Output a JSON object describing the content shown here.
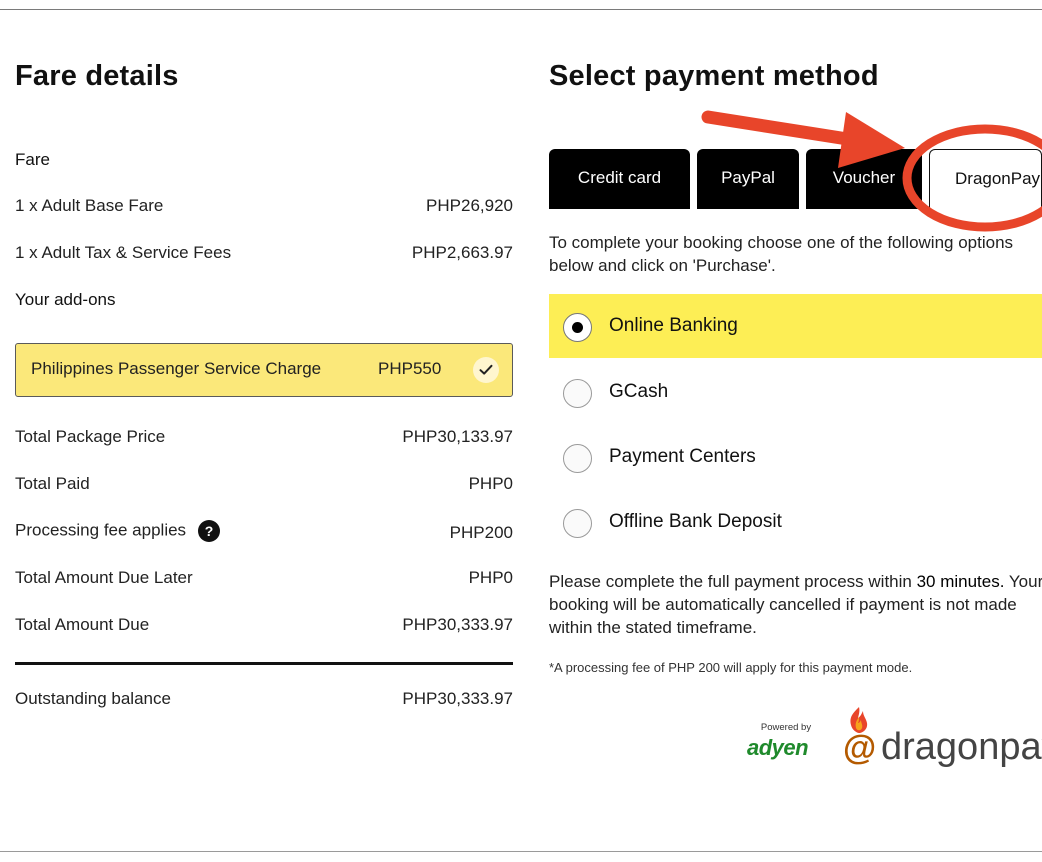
{
  "fare_details": {
    "title": "Fare details",
    "fare_section": "Fare",
    "rows": [
      {
        "label": "1 x Adult Base Fare",
        "value": "PHP26,920"
      },
      {
        "label": "1 x Adult Tax & Service Fees",
        "value": "PHP2,663.97"
      }
    ],
    "addons_section": "Your add-ons",
    "addon": {
      "label": "Philippines Passenger Service Charge",
      "price": "PHP550",
      "selected": true
    },
    "totals": [
      {
        "label": "Total Package Price",
        "value": "PHP30,133.97"
      },
      {
        "label": "Total Paid",
        "value": "PHP0"
      },
      {
        "label": "Processing fee applies",
        "value": "PHP200",
        "help_icon": "?"
      },
      {
        "label": "Total Amount Due Later",
        "value": "PHP0"
      },
      {
        "label": "Total Amount Due",
        "value": "PHP30,333.97"
      }
    ],
    "balance": {
      "label": "Outstanding balance",
      "value": "PHP30,333.97"
    }
  },
  "payment": {
    "title": "Select payment method",
    "tabs": [
      {
        "label": "Credit card",
        "active": false
      },
      {
        "label": "PayPal",
        "active": false
      },
      {
        "label": "Voucher",
        "active": false
      },
      {
        "label": "DragonPay",
        "active": true
      }
    ],
    "intro": "To complete your booking choose one of the following options below and click on 'Purchase'.",
    "options": [
      {
        "label": "Online Banking",
        "selected": true
      },
      {
        "label": "GCash",
        "selected": false
      },
      {
        "label": "Payment Centers",
        "selected": false
      },
      {
        "label": "Offline Bank Deposit",
        "selected": false
      }
    ],
    "notice_pre": "Please complete the full payment process within ",
    "notice_bold": "30 minutes.",
    "notice_post": " Your booking will be automatically cancelled if payment is not made within the stated timeframe.",
    "footnote": "*A processing fee of PHP 200 will apply for this payment mode.",
    "powered_by": "Powered by",
    "adyen_logo": "adyen",
    "dragonpay_at": "@",
    "dragonpay_logo": "dragonpay"
  },
  "colors": {
    "highlight_yellow": "#fdee55",
    "addon_yellow": "#fbe87a",
    "annotation_red": "#e8452a",
    "adyen_green": "#1f8a2c"
  }
}
